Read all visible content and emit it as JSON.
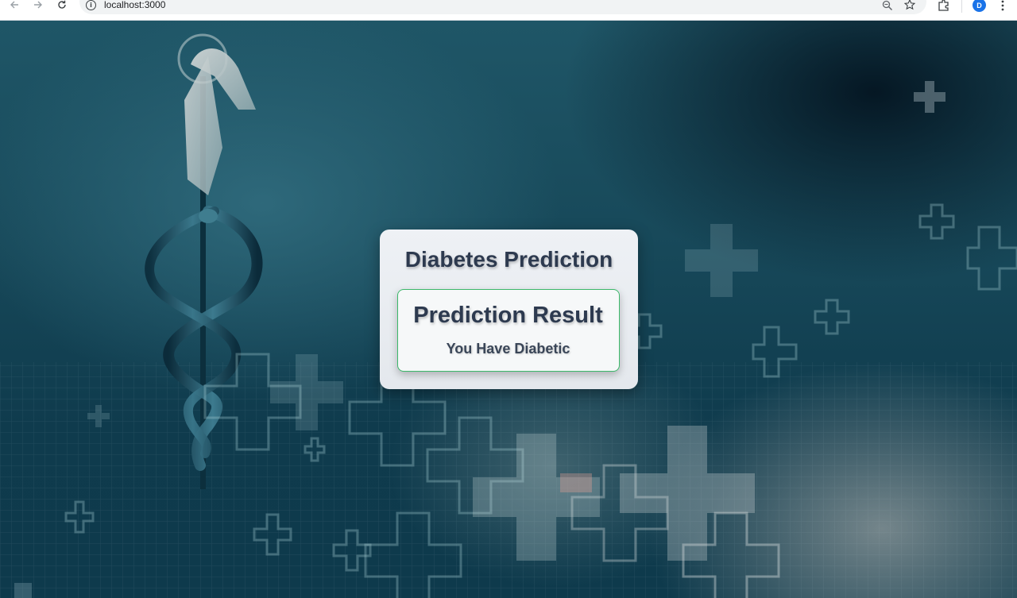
{
  "browser": {
    "url": "localhost:3000",
    "profile_initial": "D",
    "icons": {
      "back": "arrow-left-icon",
      "forward": "arrow-right-icon",
      "reload": "reload-icon",
      "site_info": "info-icon",
      "zoom": "zoom-icon",
      "bookmark": "star-icon",
      "extensions": "puzzle-icon",
      "menu": "kebab-menu-icon"
    }
  },
  "page": {
    "background": "medical caduceus backdrop with plus-cross pattern",
    "card": {
      "title": "Diabetes Prediction",
      "result": {
        "heading": "Prediction Result",
        "message": "You Have Diabetic",
        "border_color": "#3cb86a"
      }
    }
  }
}
